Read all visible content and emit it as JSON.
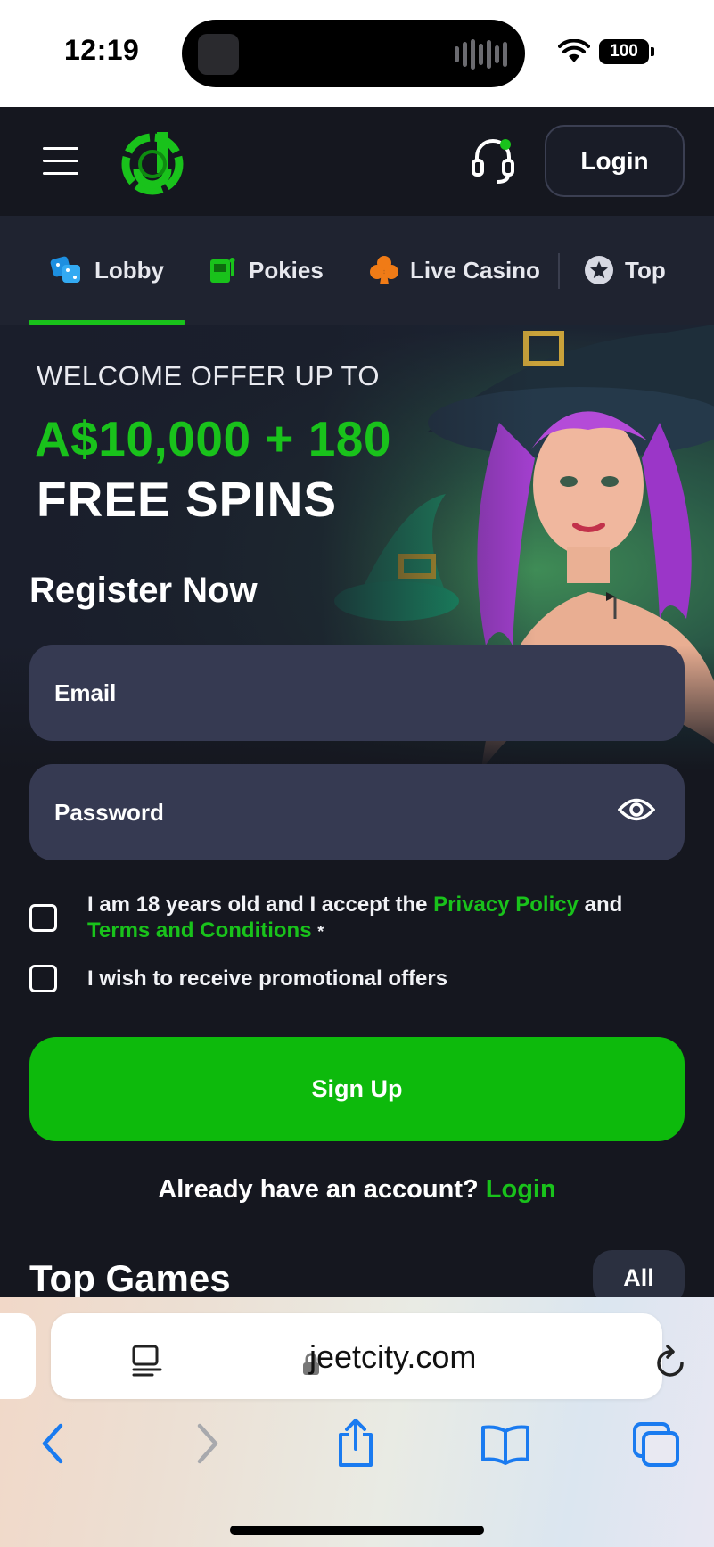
{
  "status_bar": {
    "time": "12:19",
    "battery": "100"
  },
  "header": {
    "menu_icon": "hamburger-icon",
    "logo": "jeetcity-logo",
    "support_icon": "headset-icon",
    "login_label": "Login"
  },
  "tabs": [
    {
      "label": "Lobby",
      "icon": "dice-icon",
      "active": true
    },
    {
      "label": "Pokies",
      "icon": "slot-machine-icon"
    },
    {
      "label": "Live Casino",
      "icon": "club-icon"
    },
    {
      "label": "Top",
      "icon": "star-icon"
    }
  ],
  "hero": {
    "welcome": "WELCOME OFFER UP TO",
    "amount": "A$10,000 + 180",
    "spins": "FREE SPINS"
  },
  "register": {
    "title": "Register Now",
    "email_placeholder": "Email",
    "password_placeholder": "Password",
    "consent_prefix": "I am 18 years old and I accept the",
    "privacy_link": "Privacy Policy",
    "and_word": "and",
    "terms_link": "Terms and Conditions",
    "required_mark": "*",
    "promo_label": "I wish to receive promotional offers",
    "signup_label": "Sign Up",
    "already_text": "Already have an account?",
    "already_login": "Login"
  },
  "top_games": {
    "title": "Top Games",
    "all_label": "All"
  },
  "browser": {
    "url": "jeetcity.com"
  },
  "colors": {
    "accent": "#19c21b",
    "button": "#0dba0c",
    "background": "#15171f",
    "field": "#363a52"
  }
}
